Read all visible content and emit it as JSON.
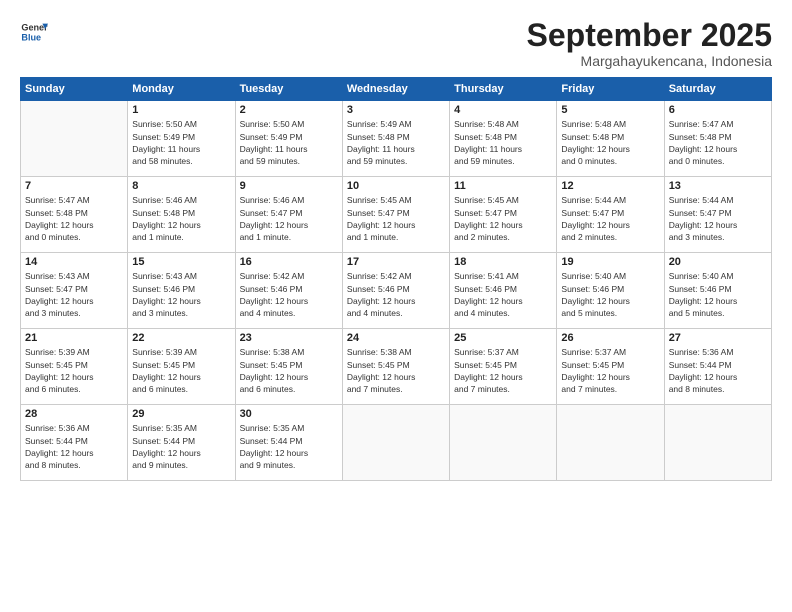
{
  "logo": {
    "line1": "General",
    "line2": "Blue"
  },
  "title": "September 2025",
  "subtitle": "Margahayukencana, Indonesia",
  "days_header": [
    "Sunday",
    "Monday",
    "Tuesday",
    "Wednesday",
    "Thursday",
    "Friday",
    "Saturday"
  ],
  "weeks": [
    [
      {
        "day": "",
        "text": ""
      },
      {
        "day": "1",
        "text": "Sunrise: 5:50 AM\nSunset: 5:49 PM\nDaylight: 11 hours\nand 58 minutes."
      },
      {
        "day": "2",
        "text": "Sunrise: 5:50 AM\nSunset: 5:49 PM\nDaylight: 11 hours\nand 59 minutes."
      },
      {
        "day": "3",
        "text": "Sunrise: 5:49 AM\nSunset: 5:48 PM\nDaylight: 11 hours\nand 59 minutes."
      },
      {
        "day": "4",
        "text": "Sunrise: 5:48 AM\nSunset: 5:48 PM\nDaylight: 11 hours\nand 59 minutes."
      },
      {
        "day": "5",
        "text": "Sunrise: 5:48 AM\nSunset: 5:48 PM\nDaylight: 12 hours\nand 0 minutes."
      },
      {
        "day": "6",
        "text": "Sunrise: 5:47 AM\nSunset: 5:48 PM\nDaylight: 12 hours\nand 0 minutes."
      }
    ],
    [
      {
        "day": "7",
        "text": "Sunrise: 5:47 AM\nSunset: 5:48 PM\nDaylight: 12 hours\nand 0 minutes."
      },
      {
        "day": "8",
        "text": "Sunrise: 5:46 AM\nSunset: 5:48 PM\nDaylight: 12 hours\nand 1 minute."
      },
      {
        "day": "9",
        "text": "Sunrise: 5:46 AM\nSunset: 5:47 PM\nDaylight: 12 hours\nand 1 minute."
      },
      {
        "day": "10",
        "text": "Sunrise: 5:45 AM\nSunset: 5:47 PM\nDaylight: 12 hours\nand 1 minute."
      },
      {
        "day": "11",
        "text": "Sunrise: 5:45 AM\nSunset: 5:47 PM\nDaylight: 12 hours\nand 2 minutes."
      },
      {
        "day": "12",
        "text": "Sunrise: 5:44 AM\nSunset: 5:47 PM\nDaylight: 12 hours\nand 2 minutes."
      },
      {
        "day": "13",
        "text": "Sunrise: 5:44 AM\nSunset: 5:47 PM\nDaylight: 12 hours\nand 3 minutes."
      }
    ],
    [
      {
        "day": "14",
        "text": "Sunrise: 5:43 AM\nSunset: 5:47 PM\nDaylight: 12 hours\nand 3 minutes."
      },
      {
        "day": "15",
        "text": "Sunrise: 5:43 AM\nSunset: 5:46 PM\nDaylight: 12 hours\nand 3 minutes."
      },
      {
        "day": "16",
        "text": "Sunrise: 5:42 AM\nSunset: 5:46 PM\nDaylight: 12 hours\nand 4 minutes."
      },
      {
        "day": "17",
        "text": "Sunrise: 5:42 AM\nSunset: 5:46 PM\nDaylight: 12 hours\nand 4 minutes."
      },
      {
        "day": "18",
        "text": "Sunrise: 5:41 AM\nSunset: 5:46 PM\nDaylight: 12 hours\nand 4 minutes."
      },
      {
        "day": "19",
        "text": "Sunrise: 5:40 AM\nSunset: 5:46 PM\nDaylight: 12 hours\nand 5 minutes."
      },
      {
        "day": "20",
        "text": "Sunrise: 5:40 AM\nSunset: 5:46 PM\nDaylight: 12 hours\nand 5 minutes."
      }
    ],
    [
      {
        "day": "21",
        "text": "Sunrise: 5:39 AM\nSunset: 5:45 PM\nDaylight: 12 hours\nand 6 minutes."
      },
      {
        "day": "22",
        "text": "Sunrise: 5:39 AM\nSunset: 5:45 PM\nDaylight: 12 hours\nand 6 minutes."
      },
      {
        "day": "23",
        "text": "Sunrise: 5:38 AM\nSunset: 5:45 PM\nDaylight: 12 hours\nand 6 minutes."
      },
      {
        "day": "24",
        "text": "Sunrise: 5:38 AM\nSunset: 5:45 PM\nDaylight: 12 hours\nand 7 minutes."
      },
      {
        "day": "25",
        "text": "Sunrise: 5:37 AM\nSunset: 5:45 PM\nDaylight: 12 hours\nand 7 minutes."
      },
      {
        "day": "26",
        "text": "Sunrise: 5:37 AM\nSunset: 5:45 PM\nDaylight: 12 hours\nand 7 minutes."
      },
      {
        "day": "27",
        "text": "Sunrise: 5:36 AM\nSunset: 5:44 PM\nDaylight: 12 hours\nand 8 minutes."
      }
    ],
    [
      {
        "day": "28",
        "text": "Sunrise: 5:36 AM\nSunset: 5:44 PM\nDaylight: 12 hours\nand 8 minutes."
      },
      {
        "day": "29",
        "text": "Sunrise: 5:35 AM\nSunset: 5:44 PM\nDaylight: 12 hours\nand 9 minutes."
      },
      {
        "day": "30",
        "text": "Sunrise: 5:35 AM\nSunset: 5:44 PM\nDaylight: 12 hours\nand 9 minutes."
      },
      {
        "day": "",
        "text": ""
      },
      {
        "day": "",
        "text": ""
      },
      {
        "day": "",
        "text": ""
      },
      {
        "day": "",
        "text": ""
      }
    ]
  ]
}
